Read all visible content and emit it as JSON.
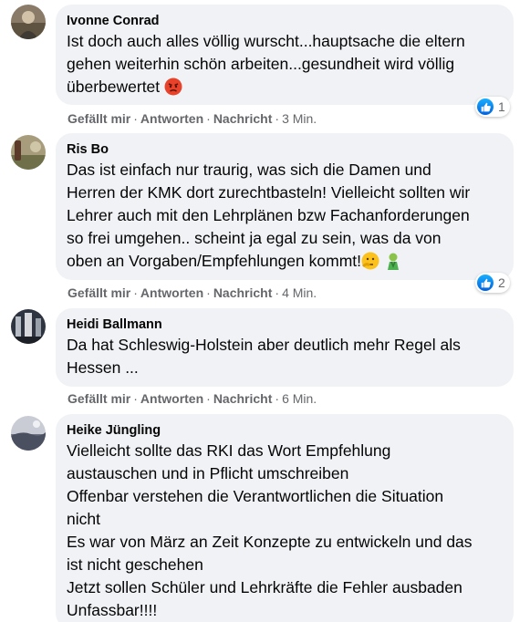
{
  "colors": {
    "bubble_bg": "#f0f2f5",
    "action_text": "#65676b",
    "like_blue": "#1877f2"
  },
  "actions": {
    "like": "Gefällt mir",
    "reply": "Antworten",
    "message": "Nachricht",
    "separator": "·"
  },
  "comments": [
    {
      "author": "Ivonne Conrad",
      "text": "Ist doch auch alles völlig wurscht...hauptsache die eltern\ngehen weiterhin schön arbeiten...gesundheit wird völlig\nüberbewertet",
      "emoji": [
        "angry-face-icon"
      ],
      "time": "3 Min.",
      "reaction_count": "1",
      "reaction_icon": "like-icon"
    },
    {
      "author": "Ris Bo",
      "text": "Das ist einfach nur traurig, was sich die Damen und\nHerren der KMK dort zurechtbasteln! Vielleicht sollten wir\nLehrer auch mit den Lehrplänen bzw Fachanforderungen\nso frei umgehen.. scheint ja egal zu sein, was da von\noben an Vorgaben/Empfehlungen kommt!",
      "emoji": [
        "thinking-face-icon",
        "nauseated-person-icon"
      ],
      "time": "4 Min.",
      "reaction_count": "2",
      "reaction_icon": "like-icon"
    },
    {
      "author": "Heidi Ballmann",
      "text": "Da hat Schleswig-Holstein aber deutlich mehr Regel als\nHessen ...",
      "time": "6 Min."
    },
    {
      "author": "Heike Jüngling",
      "text": "Vielleicht sollte das RKI das Wort Empfehlung\naustauschen und in Pflicht umschreiben\nOffenbar verstehen die Verantwortlichen die Situation\nnicht\nEs war von März an Zeit Konzepte zu entwickeln und das\nist nicht geschehen\nJetzt sollen Schüler und Lehrkräfte die Fehler ausbaden\nUnfassbar!!!!"
    }
  ]
}
